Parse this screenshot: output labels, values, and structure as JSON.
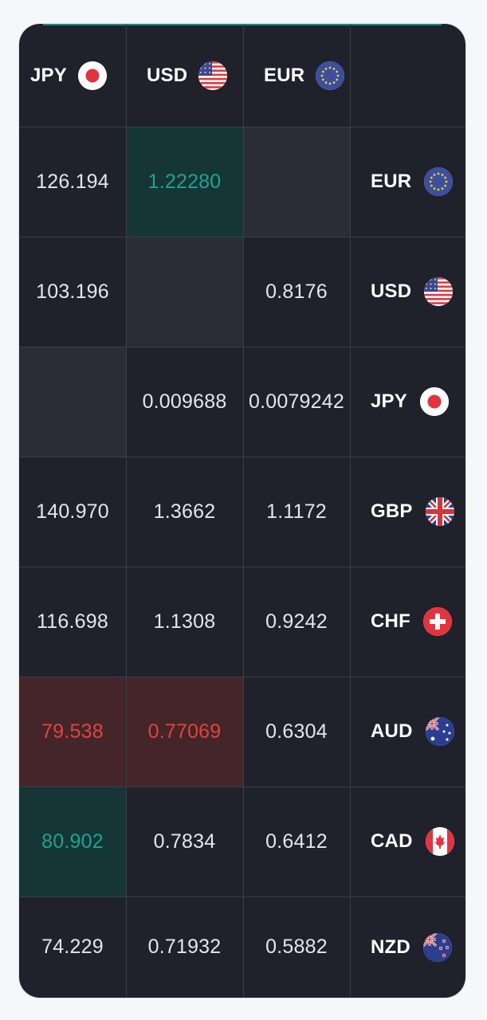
{
  "header": {
    "columns": [
      {
        "code": "JPY",
        "flag": "japan-flag-icon"
      },
      {
        "code": "USD",
        "flag": "usa-flag-icon"
      },
      {
        "code": "EUR",
        "flag": "eu-flag-icon"
      }
    ]
  },
  "rows": [
    {
      "code": "EUR",
      "flag": "eu-flag-icon",
      "cells": [
        {
          "value": "126.194",
          "state": "normal"
        },
        {
          "value": "1.22280",
          "state": "up"
        },
        {
          "value": "",
          "state": "empty"
        }
      ]
    },
    {
      "code": "USD",
      "flag": "usa-flag-icon",
      "cells": [
        {
          "value": "103.196",
          "state": "normal"
        },
        {
          "value": "",
          "state": "empty"
        },
        {
          "value": "0.8176",
          "state": "normal"
        }
      ]
    },
    {
      "code": "JPY",
      "flag": "japan-flag-icon",
      "cells": [
        {
          "value": "",
          "state": "empty"
        },
        {
          "value": "0.009688",
          "state": "normal"
        },
        {
          "value": "0.0079242",
          "state": "normal"
        }
      ]
    },
    {
      "code": "GBP",
      "flag": "uk-flag-icon",
      "cells": [
        {
          "value": "140.970",
          "state": "normal"
        },
        {
          "value": "1.3662",
          "state": "normal"
        },
        {
          "value": "1.1172",
          "state": "normal"
        }
      ]
    },
    {
      "code": "CHF",
      "flag": "swiss-flag-icon",
      "cells": [
        {
          "value": "116.698",
          "state": "normal"
        },
        {
          "value": "1.1308",
          "state": "normal"
        },
        {
          "value": "0.9242",
          "state": "normal"
        }
      ]
    },
    {
      "code": "AUD",
      "flag": "australia-flag-icon",
      "cells": [
        {
          "value": "79.538",
          "state": "down"
        },
        {
          "value": "0.77069",
          "state": "down"
        },
        {
          "value": "0.6304",
          "state": "normal"
        }
      ]
    },
    {
      "code": "CAD",
      "flag": "canada-flag-icon",
      "cells": [
        {
          "value": "80.902",
          "state": "up"
        },
        {
          "value": "0.7834",
          "state": "normal"
        },
        {
          "value": "0.6412",
          "state": "normal"
        }
      ]
    },
    {
      "code": "NZD",
      "flag": "new-zealand-flag-icon",
      "cells": [
        {
          "value": "74.229",
          "state": "normal"
        },
        {
          "value": "0.71932",
          "state": "normal"
        },
        {
          "value": "0.5882",
          "state": "normal"
        }
      ]
    }
  ],
  "colors": {
    "background": "#1f222b",
    "empty_cell": "#2a2d36",
    "up_cell": "#163537",
    "up_text": "#1aa58c",
    "down_cell": "#43252a",
    "down_text": "#e2443b",
    "grid_line": "#3a3e49"
  }
}
